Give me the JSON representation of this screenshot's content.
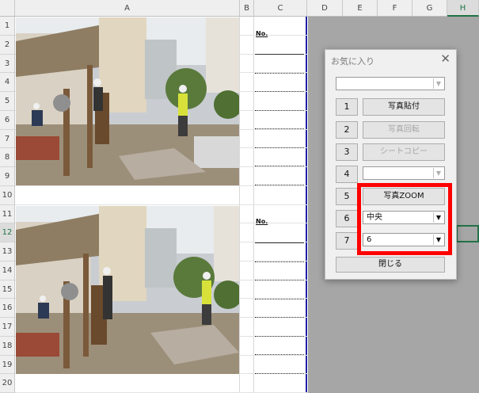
{
  "columns": [
    "A",
    "B",
    "C",
    "D",
    "E",
    "F",
    "G",
    "H"
  ],
  "rows": [
    "1",
    "2",
    "3",
    "4",
    "5",
    "6",
    "7",
    "8",
    "9",
    "10",
    "11",
    "12",
    "13",
    "14",
    "15",
    "16",
    "17",
    "18",
    "19",
    "20"
  ],
  "selected_column": "H",
  "selected_row": "12",
  "no_labels": [
    "No.",
    "No."
  ],
  "photos": [
    {
      "name": "construction-site-photo-1"
    },
    {
      "name": "construction-site-photo-2"
    }
  ],
  "dialog": {
    "title": "お気に入り",
    "close_symbol": "✕",
    "top_combo_value": "",
    "items": [
      {
        "number": "1",
        "label": "写真貼付",
        "enabled": true
      },
      {
        "number": "2",
        "label": "写真回転",
        "enabled": false
      },
      {
        "number": "3",
        "label": "シートコピー",
        "enabled": false
      },
      {
        "number": "4",
        "label": "",
        "type": "combo",
        "enabled": false
      },
      {
        "number": "5",
        "label": "写真ZOOM",
        "enabled": true
      },
      {
        "number": "6",
        "label": "中央",
        "type": "combo",
        "enabled": true
      },
      {
        "number": "7",
        "label": "6",
        "type": "combo",
        "enabled": true
      }
    ],
    "close_button": "閉じる"
  },
  "colors": {
    "highlight": "#ff0000",
    "selection": "#217346",
    "page_border": "#1f1fa8"
  }
}
